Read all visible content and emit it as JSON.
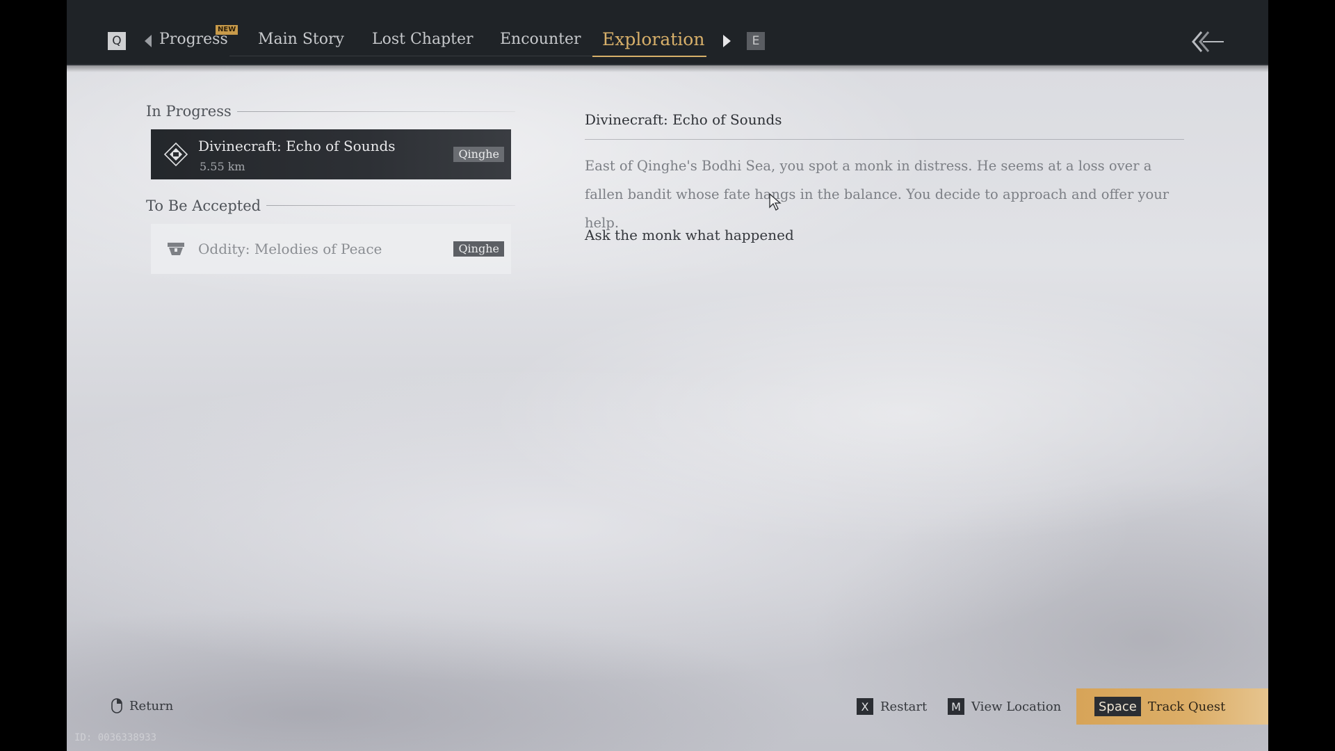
{
  "tabs": {
    "prev_key": "Q",
    "next_key": "E",
    "new_badge": "NEW",
    "items": [
      {
        "label": "Progress"
      },
      {
        "label": "Main Story"
      },
      {
        "label": "Lost Chapter"
      },
      {
        "label": "Encounter"
      },
      {
        "label": "Exploration",
        "active": true
      }
    ]
  },
  "sections": {
    "in_progress": "In Progress",
    "to_be_accepted": "To Be Accepted"
  },
  "quests": {
    "active": {
      "name": "Divinecraft: Echo of Sounds",
      "distance": "5.55 km",
      "region": "Qinghe",
      "icon": "divinecraft-diamond-icon"
    },
    "pending": {
      "name": "Oddity: Melodies of Peace",
      "region": "Qinghe",
      "icon": "oddity-chest-icon"
    }
  },
  "detail": {
    "title": "Divinecraft: Echo of Sounds",
    "description": "East of Qinghe's Bodhi Sea, you spot a monk in distress. He seems at a loss over a fallen bandit whose fate hangs in the balance. You decide to approach and offer your help.",
    "objective": "Ask the monk what happened"
  },
  "footer": {
    "return_label": "Return",
    "restart_key": "X",
    "restart_label": "Restart",
    "location_key": "M",
    "location_label": "View Location",
    "track_key": "Space",
    "track_label": "Track Quest",
    "id_text": "ID: 0036338933"
  },
  "colors": {
    "accent_gold": "#d8b06a",
    "topbar": "#1f2327",
    "track_button": "#d7a458"
  }
}
